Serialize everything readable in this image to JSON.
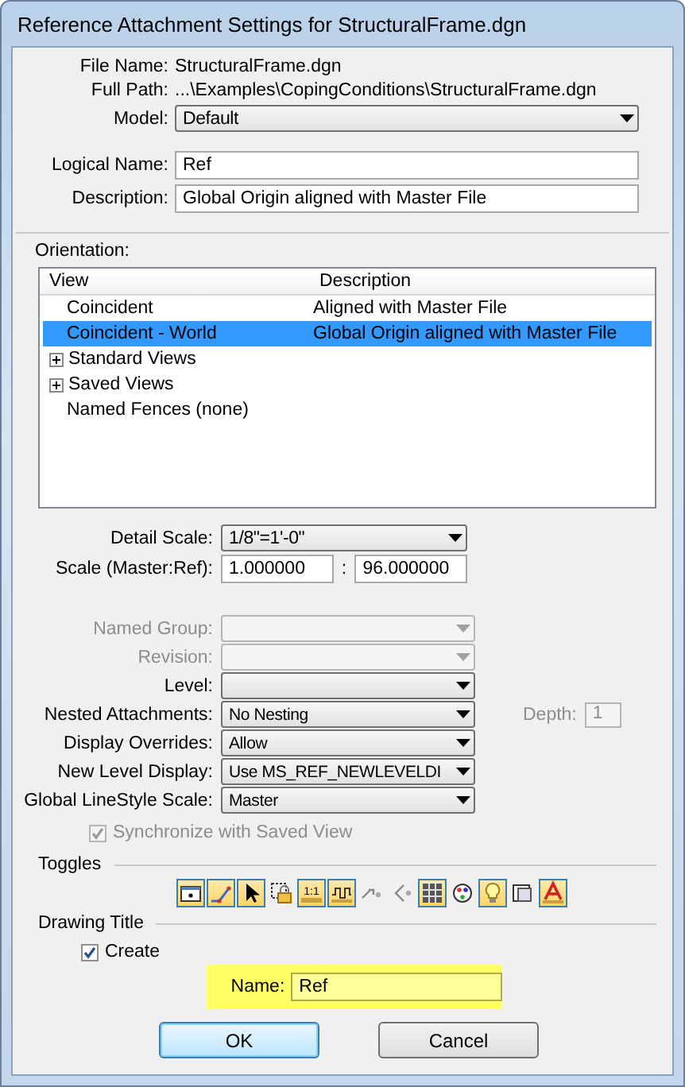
{
  "window": {
    "title": "Reference Attachment Settings for StructuralFrame.dgn"
  },
  "file_info": [
    {
      "label": "File Name:",
      "value": "StructuralFrame.dgn"
    },
    {
      "label": "Full Path:",
      "value": "...\\Examples\\CopingConditions\\StructuralFrame.dgn"
    }
  ],
  "model": {
    "label": "Model:",
    "value": "Default"
  },
  "logical_name": {
    "label": "Logical Name:",
    "value": "Ref"
  },
  "description": {
    "label": "Description:",
    "value": "Global Origin aligned with Master File"
  },
  "orientation": {
    "label": "Orientation:",
    "columns": [
      "View",
      "Description"
    ],
    "rows": [
      {
        "kind": "item",
        "view": "Coincident",
        "description": "Aligned with Master File",
        "selected": false
      },
      {
        "kind": "item",
        "view": "Coincident - World",
        "description": "Global Origin aligned with Master File",
        "selected": true
      },
      {
        "kind": "group",
        "view": "Standard Views",
        "expanded": false,
        "selected": false
      },
      {
        "kind": "group",
        "view": "Saved Views",
        "expanded": false,
        "selected": false
      },
      {
        "kind": "item",
        "view": "Named Fences (none)",
        "selected": false
      }
    ]
  },
  "detail_scale": {
    "label": "Detail Scale:",
    "value": "1/8\"=1'-0\""
  },
  "scale": {
    "label": "Scale (Master:Ref):",
    "master": "1.000000",
    "separator": ":",
    "ref": "96.000000"
  },
  "settings": [
    {
      "label": "Named Group:",
      "disabled": true
    },
    {
      "label": "Revision:",
      "disabled": true
    },
    {
      "label": "Level:",
      "disabled": false
    },
    {
      "label": "Nested Attachments:",
      "value": "No Nesting",
      "disabled": false,
      "depth": {
        "label": "Depth:",
        "value": "1",
        "disabled": true
      }
    },
    {
      "label": "Display Overrides:",
      "value": "Allow",
      "disabled": false
    },
    {
      "label": "New Level Display:",
      "value": "Use MS_REF_NEWLEVELDI",
      "disabled": false
    },
    {
      "label": "Global LineStyle Scale:",
      "value": "Master",
      "disabled": false
    }
  ],
  "synchronize": {
    "label": "Synchronize with Saved View",
    "checked": true,
    "disabled": true
  },
  "toggles": {
    "label": "Toggles",
    "items": [
      {
        "kind": "frame",
        "on": true
      },
      {
        "kind": "snap",
        "on": true
      },
      {
        "kind": "cursor",
        "on": true
      },
      {
        "kind": "lock",
        "on": false
      },
      {
        "kind": "scale",
        "text": "1:1",
        "on": true
      },
      {
        "kind": "wave",
        "on": true
      },
      {
        "kind": "link-right",
        "on": false
      },
      {
        "kind": "link-left",
        "on": false
      },
      {
        "kind": "grid",
        "on": true
      },
      {
        "kind": "palette",
        "on": false
      },
      {
        "kind": "bulb",
        "on": true
      },
      {
        "kind": "window",
        "on": false
      },
      {
        "kind": "letter",
        "on": true
      }
    ]
  },
  "drawing_title": {
    "label": "Drawing Title",
    "create": {
      "label": "Create",
      "checked": true
    },
    "name": {
      "label": "Name:",
      "value": "Ref",
      "highlighted": true
    }
  },
  "buttons": [
    {
      "label": "OK",
      "default": true
    },
    {
      "label": "Cancel",
      "default": false
    }
  ]
}
